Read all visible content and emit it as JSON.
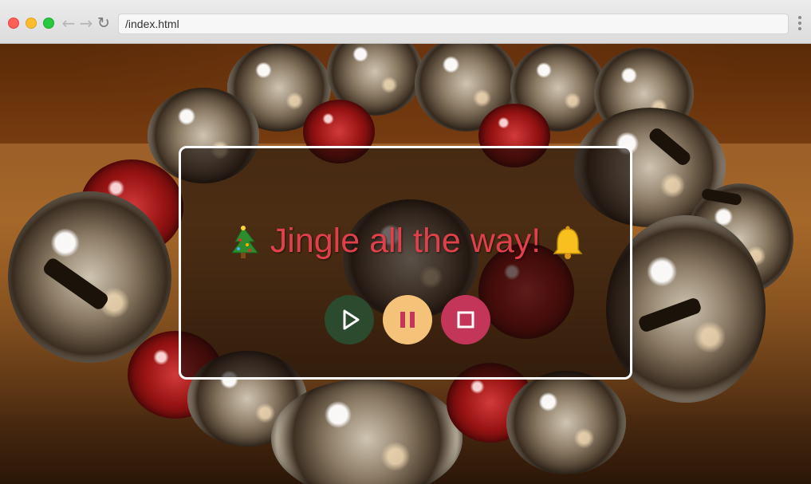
{
  "browser": {
    "url": "/index.html",
    "back_icon": "arrow-left-icon",
    "forward_icon": "arrow-right-icon",
    "reload_icon": "reload-icon",
    "menu_icon": "kebab-menu-icon"
  },
  "player": {
    "title": "Jingle all the way!",
    "leading_emoji": "christmas-tree-icon",
    "trailing_emoji": "bell-icon",
    "title_color": "#e0404a",
    "buttons": [
      {
        "name": "play",
        "icon": "play-icon",
        "color": "#2b4a2e"
      },
      {
        "name": "pause",
        "icon": "pause-icon",
        "color": "#f5c27a"
      },
      {
        "name": "stop",
        "icon": "stop-icon",
        "color": "#c4355a"
      }
    ]
  },
  "background": "jingle-bells-photo"
}
